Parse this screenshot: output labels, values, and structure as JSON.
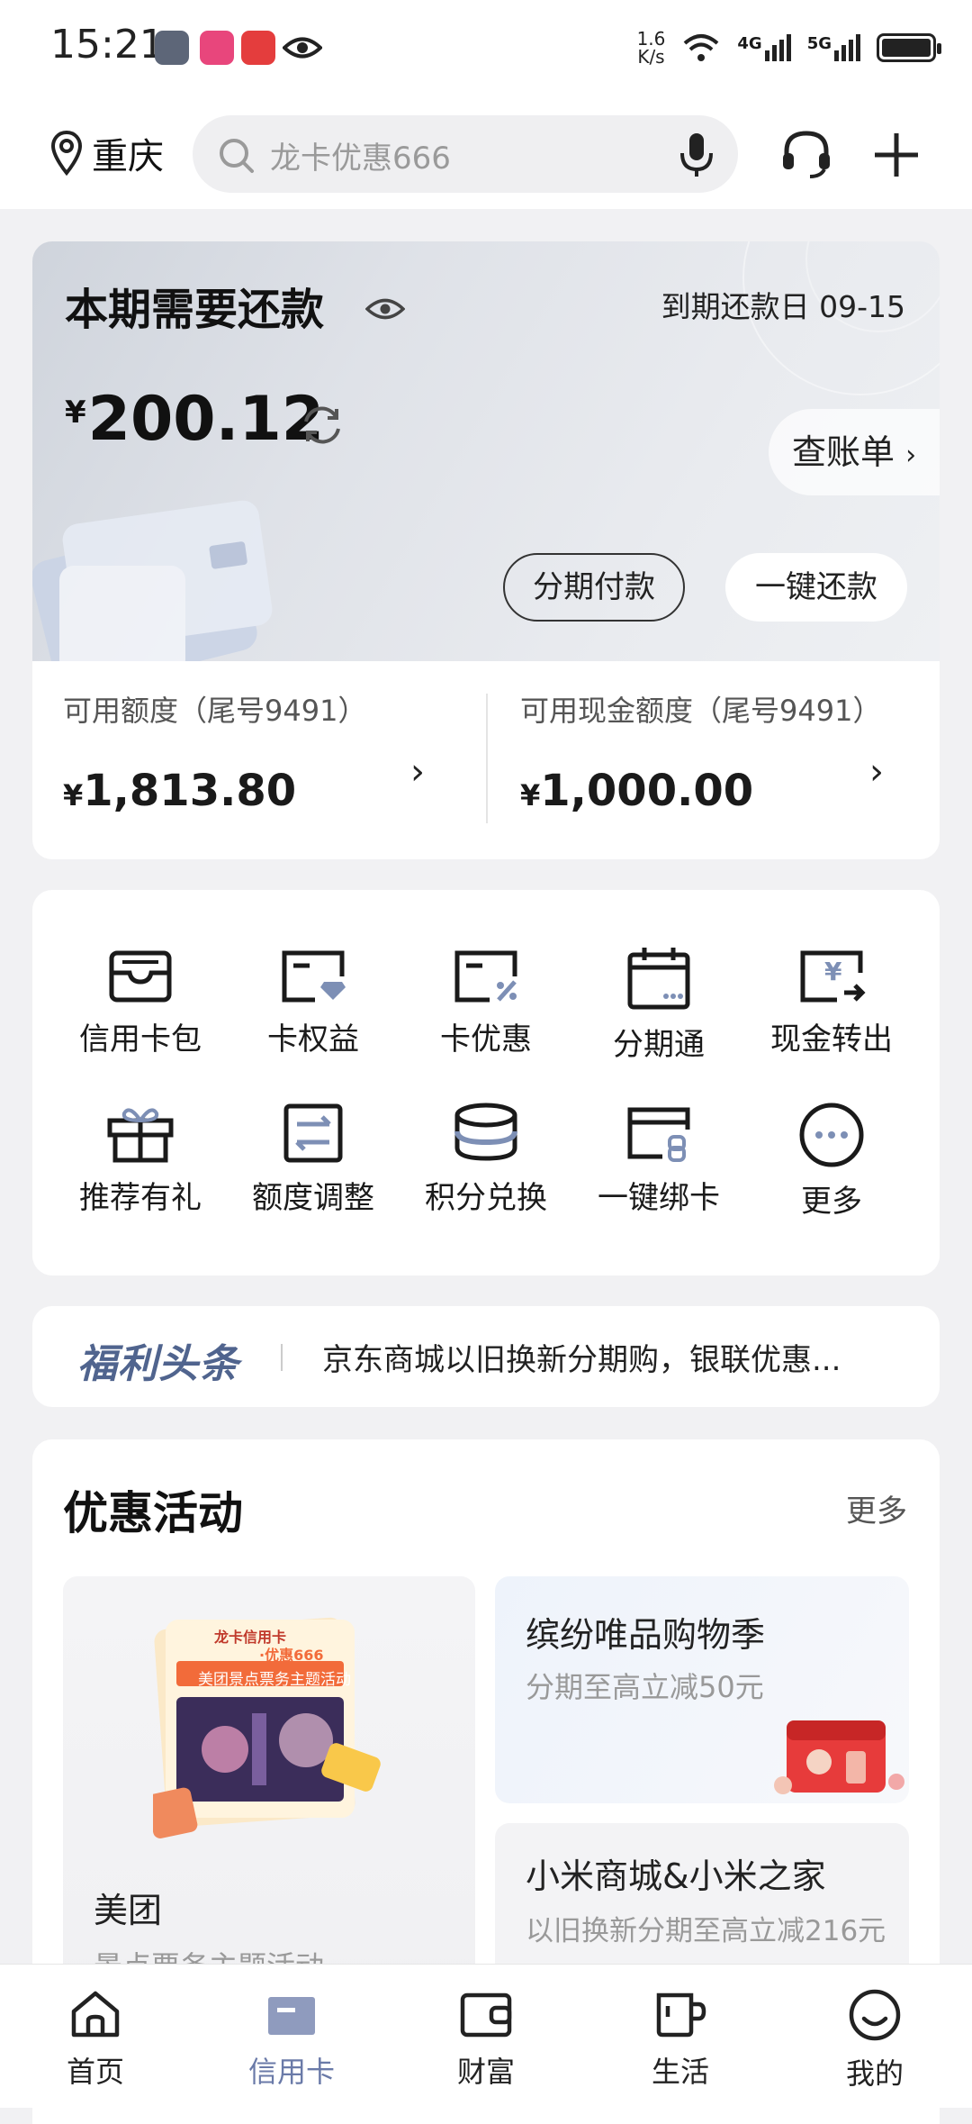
{
  "status_bar": {
    "time": "15:21",
    "speed_value": "1.6",
    "speed_unit": "K/s",
    "net1": "4G",
    "net2": "5G"
  },
  "header": {
    "city": "重庆",
    "search_placeholder": "龙卡优惠666"
  },
  "repayment": {
    "title": "本期需要还款",
    "due_label": "到期还款日 09-15",
    "currency": "¥",
    "amount": "200.12",
    "bill_label": "查账单",
    "installment_button": "分期付款",
    "repay_button": "一键还款"
  },
  "limits": [
    {
      "label": "可用额度（尾号9491）",
      "currency": "¥",
      "value": "1,813.80"
    },
    {
      "label": "可用现金额度（尾号9491）",
      "currency": "¥",
      "value": "1,000.00"
    }
  ],
  "grid": [
    {
      "label": "信用卡包",
      "icon": "card-wallet-icon"
    },
    {
      "label": "卡权益",
      "icon": "card-benefit-icon"
    },
    {
      "label": "卡优惠",
      "icon": "card-discount-icon"
    },
    {
      "label": "分期通",
      "icon": "calendar-icon"
    },
    {
      "label": "现金转出",
      "icon": "cash-transfer-icon"
    },
    {
      "label": "推荐有礼",
      "icon": "gift-icon"
    },
    {
      "label": "额度调整",
      "icon": "limit-adjust-icon"
    },
    {
      "label": "积分兑换",
      "icon": "points-coins-icon"
    },
    {
      "label": "一键绑卡",
      "icon": "bind-card-icon"
    },
    {
      "label": "更多",
      "icon": "more-icon"
    }
  ],
  "news": {
    "brand": "福利头条",
    "text": "京东商城以旧换新分期购，银联优惠..."
  },
  "promotions": {
    "title": "优惠活动",
    "more": "更多",
    "cards": [
      {
        "title": "美团",
        "subtitle": "景点票务主题活动",
        "poster_line1": "龙卡信用卡",
        "poster_line2": "·优惠666",
        "poster_banner": "美团景点票务主题活动"
      },
      {
        "title": "缤纷唯品购物季",
        "subtitle": "分期至高立减50元"
      },
      {
        "title": "小米商城&小米之家",
        "subtitle": "以旧换新分期至高立减216元"
      }
    ]
  },
  "nav": [
    {
      "label": "首页",
      "icon": "home-icon",
      "active": false
    },
    {
      "label": "信用卡",
      "icon": "credit-card-icon",
      "active": true
    },
    {
      "label": "财富",
      "icon": "wallet-icon",
      "active": false
    },
    {
      "label": "生活",
      "icon": "cup-icon",
      "active": false
    },
    {
      "label": "我的",
      "icon": "profile-icon",
      "active": false
    }
  ],
  "colors": {
    "accent": "#6a7aa8",
    "news_brand": "#50648e",
    "poster_orange": "#f26b3a"
  }
}
